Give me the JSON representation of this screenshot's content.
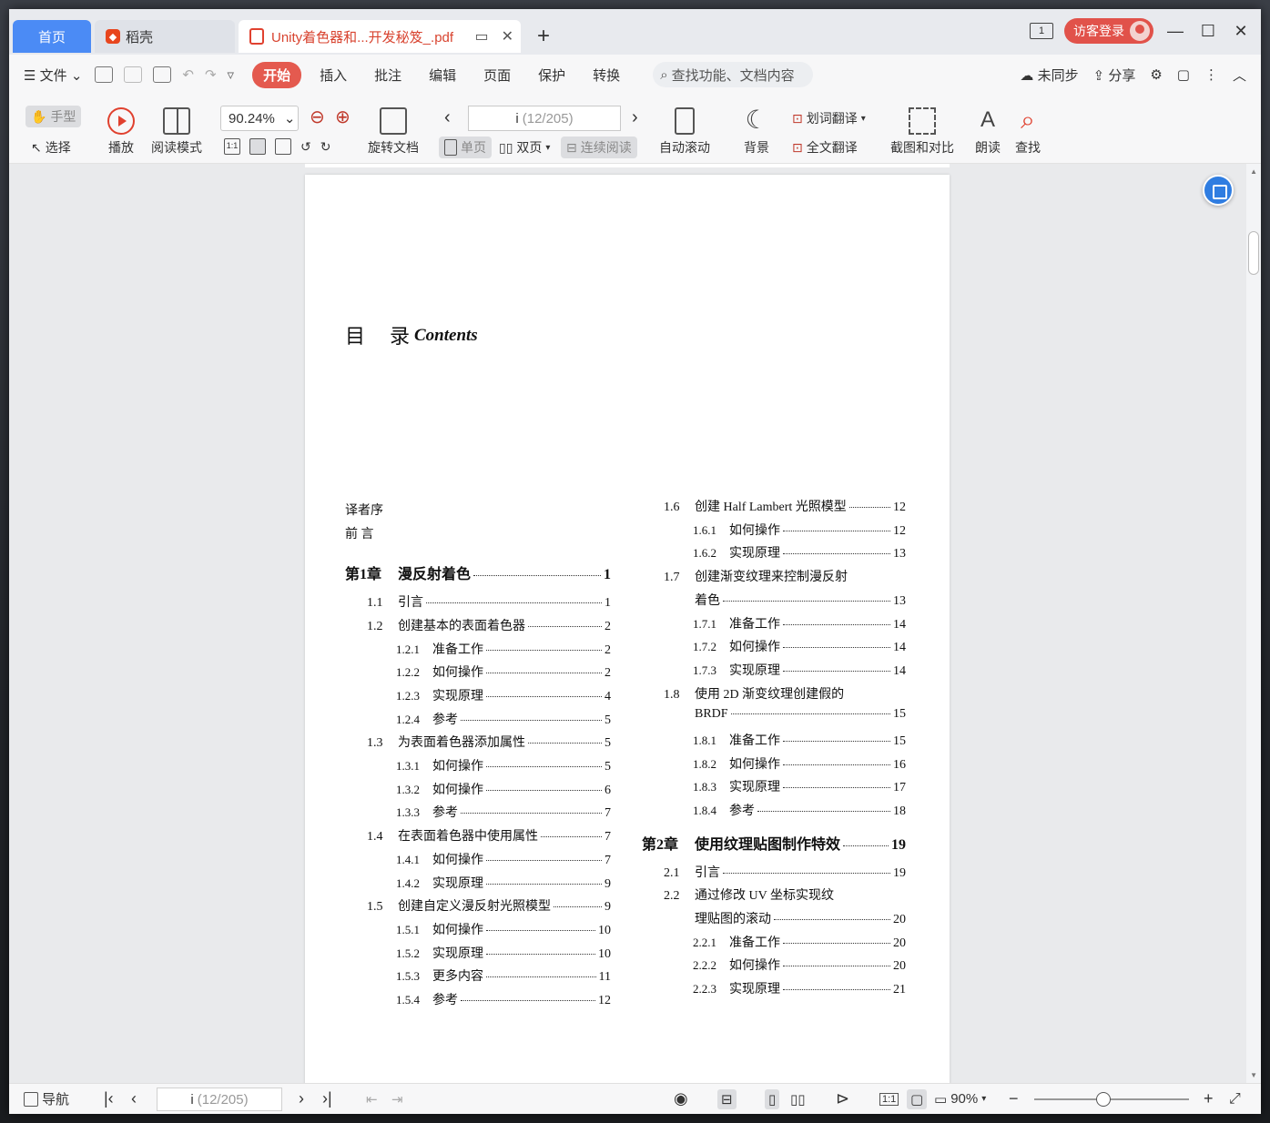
{
  "tabs": {
    "home": "首页",
    "daoke": "稻壳",
    "document": "Unity着色器和...开发秘笈_.pdf",
    "add": "+"
  },
  "window": {
    "page_badge": "1",
    "login": "访客登录",
    "minimize": "—",
    "maximize": "☐",
    "close": "✕"
  },
  "menu": {
    "file": "文件",
    "items": [
      "开始",
      "插入",
      "批注",
      "编辑",
      "页面",
      "保护",
      "转换"
    ],
    "search_placeholder": "查找功能、文档内容",
    "sync": "未同步",
    "share": "分享"
  },
  "ribbon": {
    "hand": "手型",
    "select": "选择",
    "play": "播放",
    "read_mode": "阅读模式",
    "zoom": "90.24%",
    "rotate": "旋转文档",
    "page_current": "i",
    "page_total": "(12/205)",
    "single": "单页",
    "double": "双页",
    "continuous": "连续阅读",
    "auto_scroll": "自动滚动",
    "background": "背景",
    "word_translate": "划词翻译",
    "full_translate": "全文翻译",
    "screenshot_compare": "截图和对比",
    "read_aloud": "朗读",
    "find": "查找",
    "actual_size": "1:1"
  },
  "toc": {
    "title": "目  录",
    "title_en": "Contents",
    "left": [
      {
        "num": "译者序",
        "label": "",
        "pg": "",
        "type": "plain"
      },
      {
        "num": "前  言",
        "label": "",
        "pg": "",
        "type": "plain"
      },
      {
        "num": "第1章",
        "label": "漫反射着色",
        "pg": "1",
        "type": "chapter"
      },
      {
        "num": "1.1",
        "label": "引言",
        "pg": "1",
        "type": "section"
      },
      {
        "num": "1.2",
        "label": "创建基本的表面着色器",
        "pg": "2",
        "type": "section"
      },
      {
        "num": "1.2.1",
        "label": "准备工作",
        "pg": "2",
        "type": "sub"
      },
      {
        "num": "1.2.2",
        "label": "如何操作",
        "pg": "2",
        "type": "sub"
      },
      {
        "num": "1.2.3",
        "label": "实现原理",
        "pg": "4",
        "type": "sub"
      },
      {
        "num": "1.2.4",
        "label": "参考",
        "pg": "5",
        "type": "sub"
      },
      {
        "num": "1.3",
        "label": "为表面着色器添加属性",
        "pg": "5",
        "type": "section"
      },
      {
        "num": "1.3.1",
        "label": "如何操作",
        "pg": "5",
        "type": "sub"
      },
      {
        "num": "1.3.2",
        "label": "如何操作",
        "pg": "6",
        "type": "sub"
      },
      {
        "num": "1.3.3",
        "label": "参考",
        "pg": "7",
        "type": "sub"
      },
      {
        "num": "1.4",
        "label": "在表面着色器中使用属性",
        "pg": "7",
        "type": "section"
      },
      {
        "num": "1.4.1",
        "label": "如何操作",
        "pg": "7",
        "type": "sub"
      },
      {
        "num": "1.4.2",
        "label": "实现原理",
        "pg": "9",
        "type": "sub"
      },
      {
        "num": "1.5",
        "label": "创建自定义漫反射光照模型",
        "pg": "9",
        "type": "section"
      },
      {
        "num": "1.5.1",
        "label": "如何操作",
        "pg": "10",
        "type": "sub"
      },
      {
        "num": "1.5.2",
        "label": "实现原理",
        "pg": "10",
        "type": "sub"
      },
      {
        "num": "1.5.3",
        "label": "更多内容",
        "pg": "11",
        "type": "sub"
      },
      {
        "num": "1.5.4",
        "label": "参考",
        "pg": "12",
        "type": "sub"
      }
    ],
    "right": [
      {
        "num": "1.6",
        "label": "创建 Half Lambert 光照模型",
        "pg": "12",
        "type": "section"
      },
      {
        "num": "1.6.1",
        "label": "如何操作",
        "pg": "12",
        "type": "sub"
      },
      {
        "num": "1.6.2",
        "label": "实现原理",
        "pg": "13",
        "type": "sub"
      },
      {
        "num": "1.7",
        "label": "创建渐变纹理来控制漫反射",
        "pg": "",
        "type": "section-open"
      },
      {
        "num": "",
        "label": "着色",
        "pg": "13",
        "type": "cont"
      },
      {
        "num": "1.7.1",
        "label": "准备工作",
        "pg": "14",
        "type": "sub"
      },
      {
        "num": "1.7.2",
        "label": "如何操作",
        "pg": "14",
        "type": "sub"
      },
      {
        "num": "1.7.3",
        "label": "实现原理",
        "pg": "14",
        "type": "sub"
      },
      {
        "num": "1.8",
        "label": "使用 2D 渐变纹理创建假的",
        "pg": "",
        "type": "section-open"
      },
      {
        "num": "",
        "label": "BRDF",
        "pg": "15",
        "type": "cont"
      },
      {
        "num": "1.8.1",
        "label": "准备工作",
        "pg": "15",
        "type": "sub"
      },
      {
        "num": "1.8.2",
        "label": "如何操作",
        "pg": "16",
        "type": "sub"
      },
      {
        "num": "1.8.3",
        "label": "实现原理",
        "pg": "17",
        "type": "sub"
      },
      {
        "num": "1.8.4",
        "label": "参考",
        "pg": "18",
        "type": "sub"
      },
      {
        "num": "第2章",
        "label": "使用纹理贴图制作特效",
        "pg": "19",
        "type": "chapter"
      },
      {
        "num": "2.1",
        "label": "引言",
        "pg": "19",
        "type": "section"
      },
      {
        "num": "2.2",
        "label": "通过修改 UV 坐标实现纹",
        "pg": "",
        "type": "section-open"
      },
      {
        "num": "",
        "label": "理贴图的滚动",
        "pg": "20",
        "type": "cont"
      },
      {
        "num": "2.2.1",
        "label": "准备工作",
        "pg": "20",
        "type": "sub"
      },
      {
        "num": "2.2.2",
        "label": "如何操作",
        "pg": "20",
        "type": "sub"
      },
      {
        "num": "2.2.3",
        "label": "实现原理",
        "pg": "21",
        "type": "sub"
      }
    ]
  },
  "status": {
    "nav": "导航",
    "page_current": "i",
    "page_total": "(12/205)",
    "zoom": "90%",
    "actual_size": "1:1"
  }
}
